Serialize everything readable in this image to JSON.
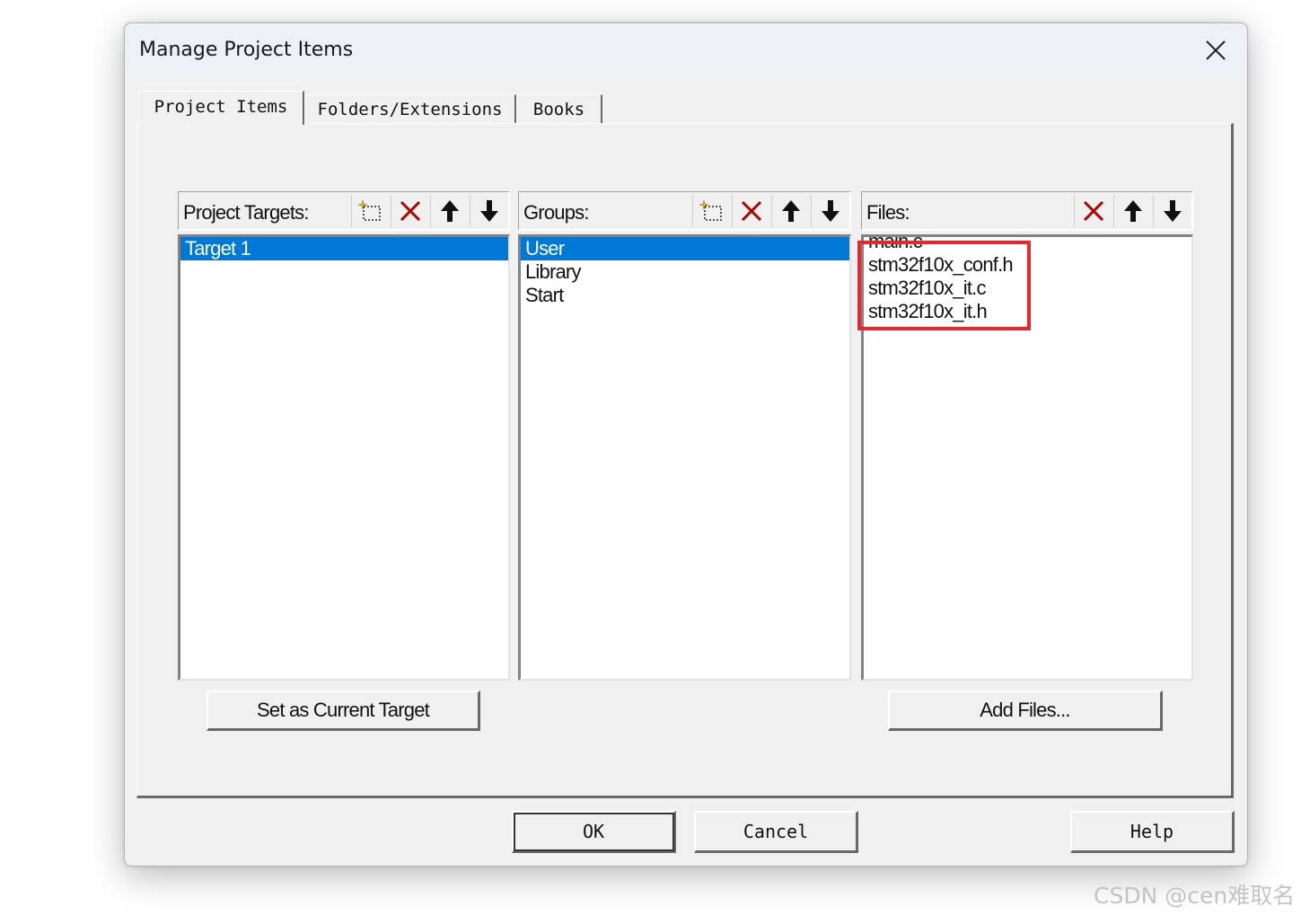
{
  "window": {
    "title": "Manage Project Items"
  },
  "tabs": [
    {
      "label": "Project Items",
      "active": true
    },
    {
      "label": "Folders/Extensions",
      "active": false
    },
    {
      "label": "Books",
      "active": false
    }
  ],
  "targets": {
    "header": "Project Targets:",
    "toolbar_icons": [
      "new-item-icon",
      "delete-icon",
      "move-up-icon",
      "move-down-icon"
    ],
    "items": [
      "Target 1"
    ],
    "selected": "Target 1",
    "set_current_button": "Set as Current Target"
  },
  "groups": {
    "header": "Groups:",
    "toolbar_icons": [
      "new-item-icon",
      "delete-icon",
      "move-up-icon",
      "move-down-icon"
    ],
    "items": [
      "User",
      "Library",
      "Start"
    ],
    "selected": "User"
  },
  "files": {
    "header": "Files:",
    "toolbar_icons": [
      "delete-icon",
      "move-up-icon",
      "move-down-icon"
    ],
    "items": [
      "main.c",
      "stm32f10x_conf.h",
      "stm32f10x_it.c",
      "stm32f10x_it.h"
    ],
    "add_files_button": "Add Files..."
  },
  "buttons": {
    "ok": "OK",
    "cancel": "Cancel",
    "help": "Help"
  },
  "watermark": "CSDN @cen难取名",
  "colors": {
    "selection": "#0078d7",
    "delete_icon": "#b00000",
    "highlight_box": "#e8262b",
    "dialog_bg": "#f0f0f0",
    "titlebar_bg": "#edf1f6"
  }
}
